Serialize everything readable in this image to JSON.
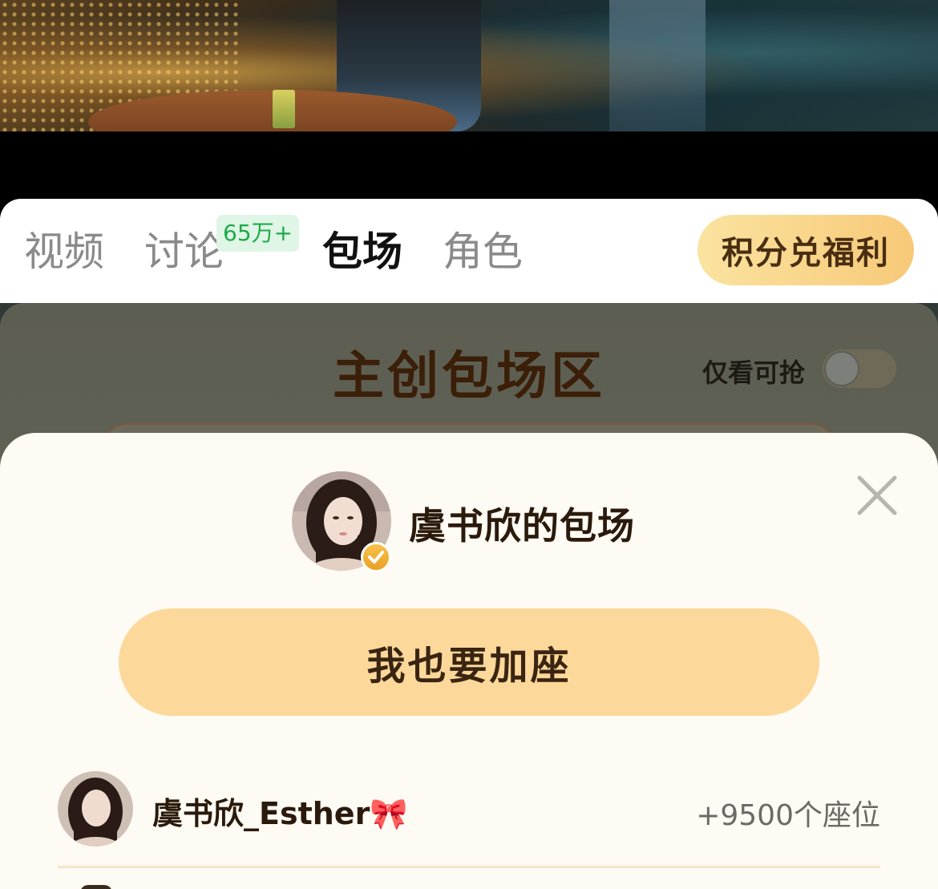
{
  "tabs": {
    "videos": "视频",
    "discussion": "讨论",
    "discussion_badge": "65万+",
    "screening": "包场",
    "roles": "角色",
    "active": "screening"
  },
  "points_button": "积分兑福利",
  "zone": {
    "title": "主创包场区",
    "only_grab_label": "仅看可抢",
    "only_grab_toggle_on": false
  },
  "sheet": {
    "title": "虞书欣的包场",
    "join_button": "我也要加座",
    "list": [
      {
        "name": "虞书欣_Esther🎀",
        "seats": "+9500个座位"
      }
    ]
  },
  "colors": {
    "accent": "#fdd89b",
    "badge_green": "#1faa4a",
    "title_brown": "#3b1f08"
  },
  "icons": {
    "close": "close-icon",
    "verified": "verified-check-icon"
  }
}
